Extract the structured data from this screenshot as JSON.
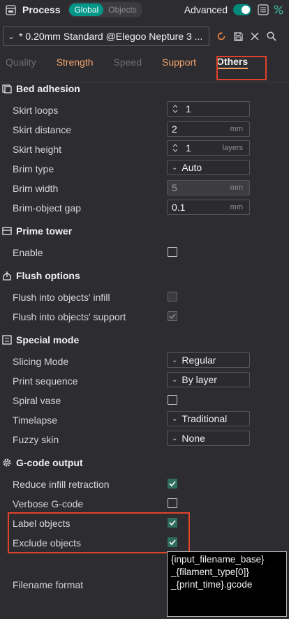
{
  "topbar": {
    "title": "Process",
    "scope_global": "Global",
    "scope_objects": "Objects",
    "advanced_label": "Advanced"
  },
  "preset": {
    "name": "* 0.20mm Standard @Elegoo Nepture 3 ..."
  },
  "tabs": [
    {
      "label": "Quality"
    },
    {
      "label": "Strength"
    },
    {
      "label": "Speed"
    },
    {
      "label": "Support"
    },
    {
      "label": "Others"
    }
  ],
  "sections": {
    "bed_adhesion": {
      "title": "Bed adhesion",
      "skirt_loops": {
        "label": "Skirt loops",
        "value": "1"
      },
      "skirt_distance": {
        "label": "Skirt distance",
        "value": "2",
        "unit": "mm"
      },
      "skirt_height": {
        "label": "Skirt height",
        "value": "1",
        "unit": "layers"
      },
      "brim_type": {
        "label": "Brim type",
        "value": "Auto"
      },
      "brim_width": {
        "label": "Brim width",
        "value": "5",
        "unit": "mm"
      },
      "brim_gap": {
        "label": "Brim-object gap",
        "value": "0.1",
        "unit": "mm"
      }
    },
    "prime_tower": {
      "title": "Prime tower",
      "enable": {
        "label": "Enable",
        "checked": false
      }
    },
    "flush": {
      "title": "Flush options",
      "infill": {
        "label": "Flush into objects' infill",
        "checked": false
      },
      "support": {
        "label": "Flush into objects' support",
        "checked": true
      }
    },
    "special": {
      "title": "Special mode",
      "slicing_mode": {
        "label": "Slicing Mode",
        "value": "Regular"
      },
      "print_sequence": {
        "label": "Print sequence",
        "value": "By layer"
      },
      "spiral_vase": {
        "label": "Spiral vase",
        "checked": false
      },
      "timelapse": {
        "label": "Timelapse",
        "value": "Traditional"
      },
      "fuzzy_skin": {
        "label": "Fuzzy skin",
        "value": "None"
      }
    },
    "gcode": {
      "title": "G-code output",
      "reduce_infill": {
        "label": "Reduce infill retraction",
        "checked": true
      },
      "verbose": {
        "label": "Verbose G-code",
        "checked": false
      },
      "label_objects": {
        "label": "Label objects",
        "checked": true
      },
      "exclude_objects": {
        "label": "Exclude objects",
        "checked": true
      },
      "filename_format": {
        "label": "Filename format",
        "line1": "{input_filename_base}",
        "line2": "_{filament_type[0]}",
        "line3": "_{print_time}.gcode"
      }
    }
  },
  "colors": {
    "background": "#2d2d31",
    "accent": "#009688",
    "tab_orange": "#f3a36b",
    "highlight": "#e0432a",
    "check": "#2f6e5c"
  }
}
